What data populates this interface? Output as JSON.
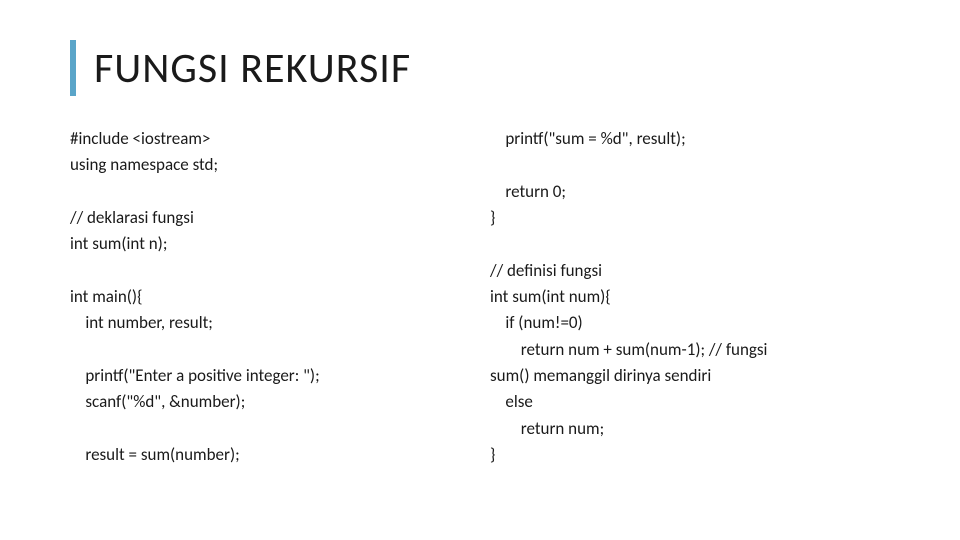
{
  "title": "FUNGSI REKURSIF",
  "left": {
    "l1": "#include <iostream>",
    "l2": "using namespace std;",
    "l3": "",
    "l4": "// deklarasi fungsi",
    "l5": "int sum(int n);",
    "l6": "",
    "l7": "int main(){",
    "l8": "    int number, result;",
    "l9": "",
    "l10": "    printf(\"Enter a positive integer: \");",
    "l11": "    scanf(\"%d\", &number);",
    "l12": "",
    "l13": "    result = sum(number);"
  },
  "right": {
    "l1": "    printf(\"sum = %d\", result);",
    "l2": "",
    "l3": "    return 0;",
    "l4": "}",
    "l5": "",
    "l6": "// definisi fungsi",
    "l7": "int sum(int num){",
    "l8": "    if (num!=0)",
    "l9": "        return num + sum(num-1); // fungsi",
    "l10": "sum() memanggil dirinya sendiri",
    "l11": "    else",
    "l12": "        return num;",
    "l13": "}"
  }
}
